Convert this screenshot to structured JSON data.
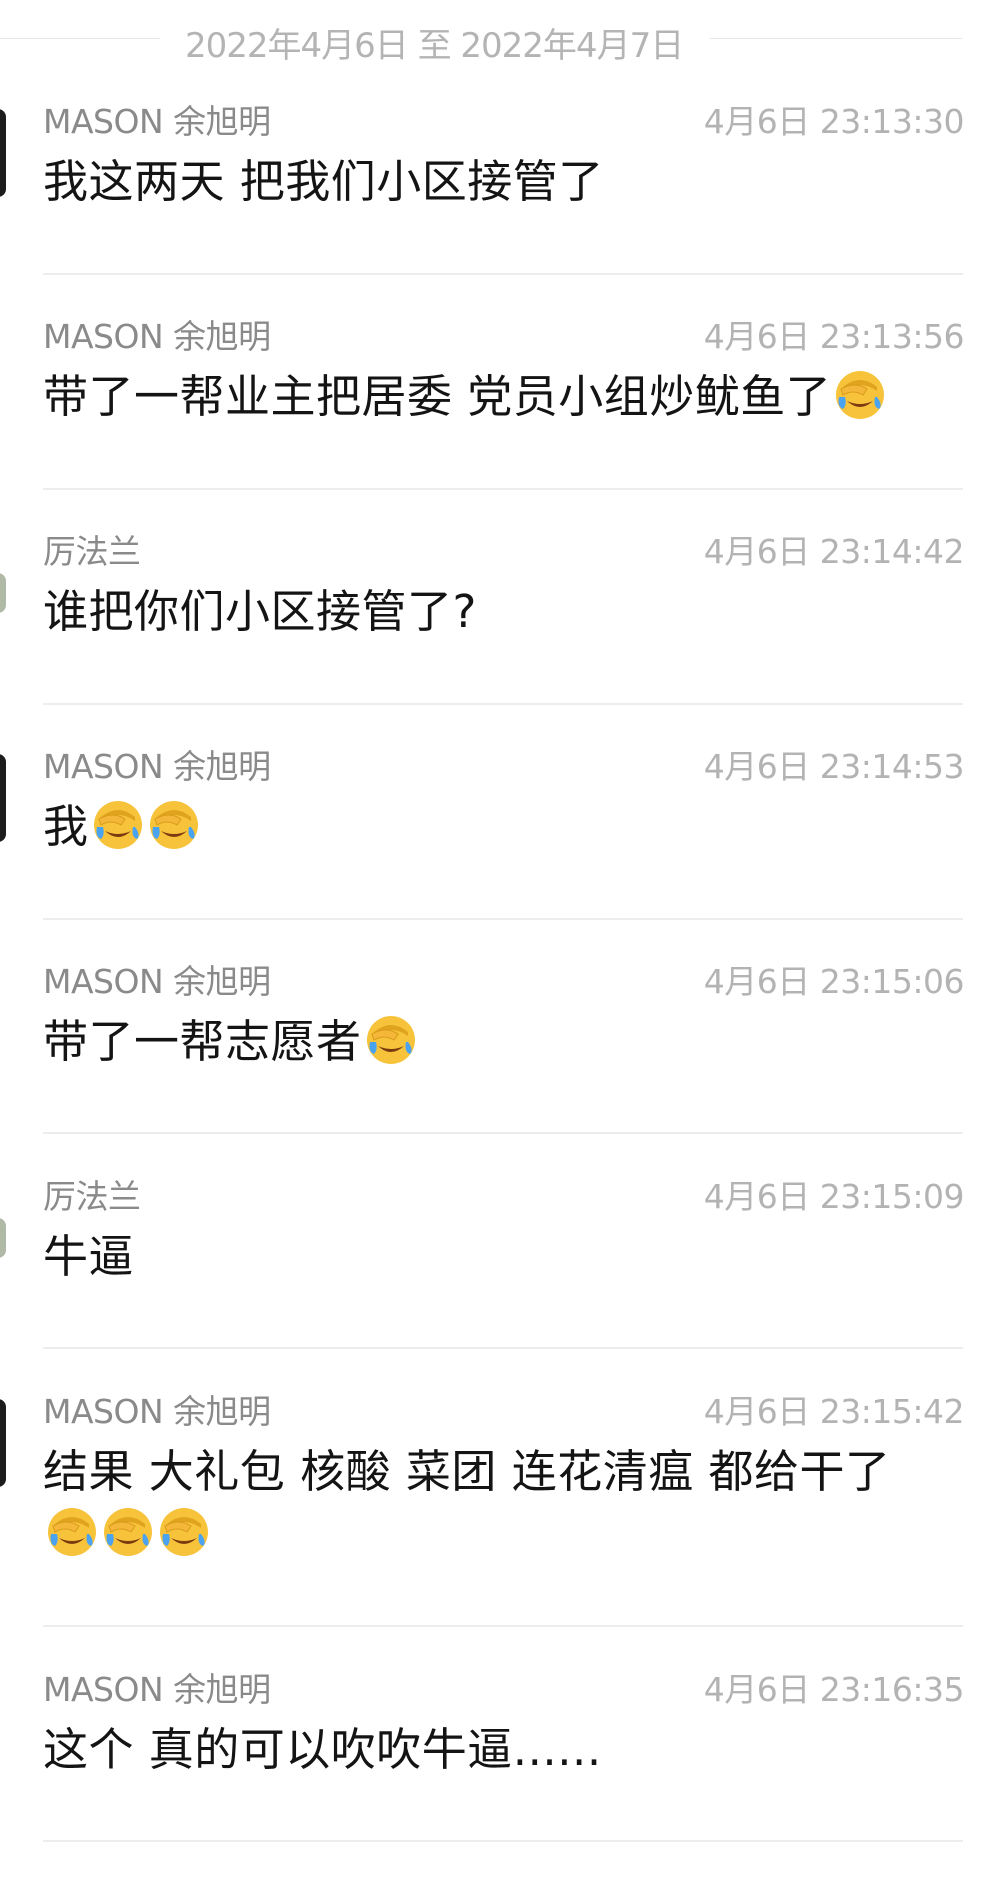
{
  "date_range": "2022年4月6日 至 2022年4月7日",
  "messages": [
    {
      "sender": "MASON 余旭明",
      "time": "4月6日 23:13:30",
      "text": "我这两天 把我们小区接管了",
      "emoji_count": 0,
      "text2": "",
      "emoji_count2": 0
    },
    {
      "sender": "MASON 余旭明",
      "time": "4月6日 23:13:56",
      "text": "带了一帮业主把居委 党员小组炒鱿鱼了",
      "emoji_count": 1,
      "text2": "",
      "emoji_count2": 0
    },
    {
      "sender": "厉法兰",
      "time": "4月6日 23:14:42",
      "text": "谁把你们小区接管了?",
      "emoji_count": 0,
      "text2": "",
      "emoji_count2": 0
    },
    {
      "sender": "MASON 余旭明",
      "time": "4月6日 23:14:53",
      "text": "我",
      "emoji_count": 2,
      "text2": "",
      "emoji_count2": 0
    },
    {
      "sender": "MASON 余旭明",
      "time": "4月6日 23:15:06",
      "text": "带了一帮志愿者",
      "emoji_count": 1,
      "text2": "",
      "emoji_count2": 0
    },
    {
      "sender": "厉法兰",
      "time": "4月6日 23:15:09",
      "text": "牛逼",
      "emoji_count": 0,
      "text2": "",
      "emoji_count2": 0
    },
    {
      "sender": "MASON 余旭明",
      "time": "4月6日 23:15:42",
      "text": "结果 大礼包 核酸 菜团 连花清瘟 都给干了",
      "emoji_count": 0,
      "text2": "",
      "emoji_count2": 3
    },
    {
      "sender": "MASON 余旭明",
      "time": "4月6日 23:16:35",
      "text": "这个 真的可以吹吹牛逼......",
      "emoji_count": 0,
      "text2": "",
      "emoji_count2": 0
    }
  ],
  "emoji_name": "face-palm-crying-emoji",
  "colors": {
    "sender": "#8a8a8a",
    "time": "#b3b3b3",
    "content": "#141414",
    "divider": "#ededed",
    "date_header": "#b4b4b4",
    "emoji_face": "#f7c33a",
    "emoji_tear": "#4aa3f0"
  }
}
